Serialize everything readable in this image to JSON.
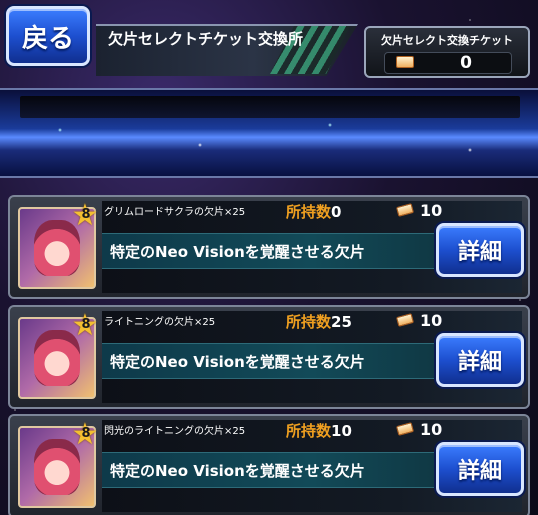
{
  "header": {
    "back_label": "戻る",
    "title": "欠片セレクトチケット交換所",
    "ticket_label": "欠片セレクト交換チケット",
    "ticket_count": "0"
  },
  "items": [
    {
      "rarity": "8",
      "name": "グリムロードサクラの欠片×25",
      "owned_label": "所持数",
      "owned_value": "0",
      "cost": "10",
      "description": "特定のNeo Visionを覚醒させる欠片",
      "detail_label": "詳細"
    },
    {
      "rarity": "8",
      "name": "ライトニングの欠片×25",
      "owned_label": "所持数",
      "owned_value": "25",
      "cost": "10",
      "description": "特定のNeo Visionを覚醒させる欠片",
      "detail_label": "詳細"
    },
    {
      "rarity": "8",
      "name": "閃光のライトニングの欠片×25",
      "owned_label": "所持数",
      "owned_value": "10",
      "cost": "10",
      "description": "特定のNeo Visionを覚醒させる欠片",
      "detail_label": "詳細"
    }
  ],
  "icons": {
    "ticket": "ticket-icon",
    "rarity": "star-icon"
  },
  "colors": {
    "accent_blue": "#1d4fcf",
    "owned_label": "#f0a020"
  }
}
